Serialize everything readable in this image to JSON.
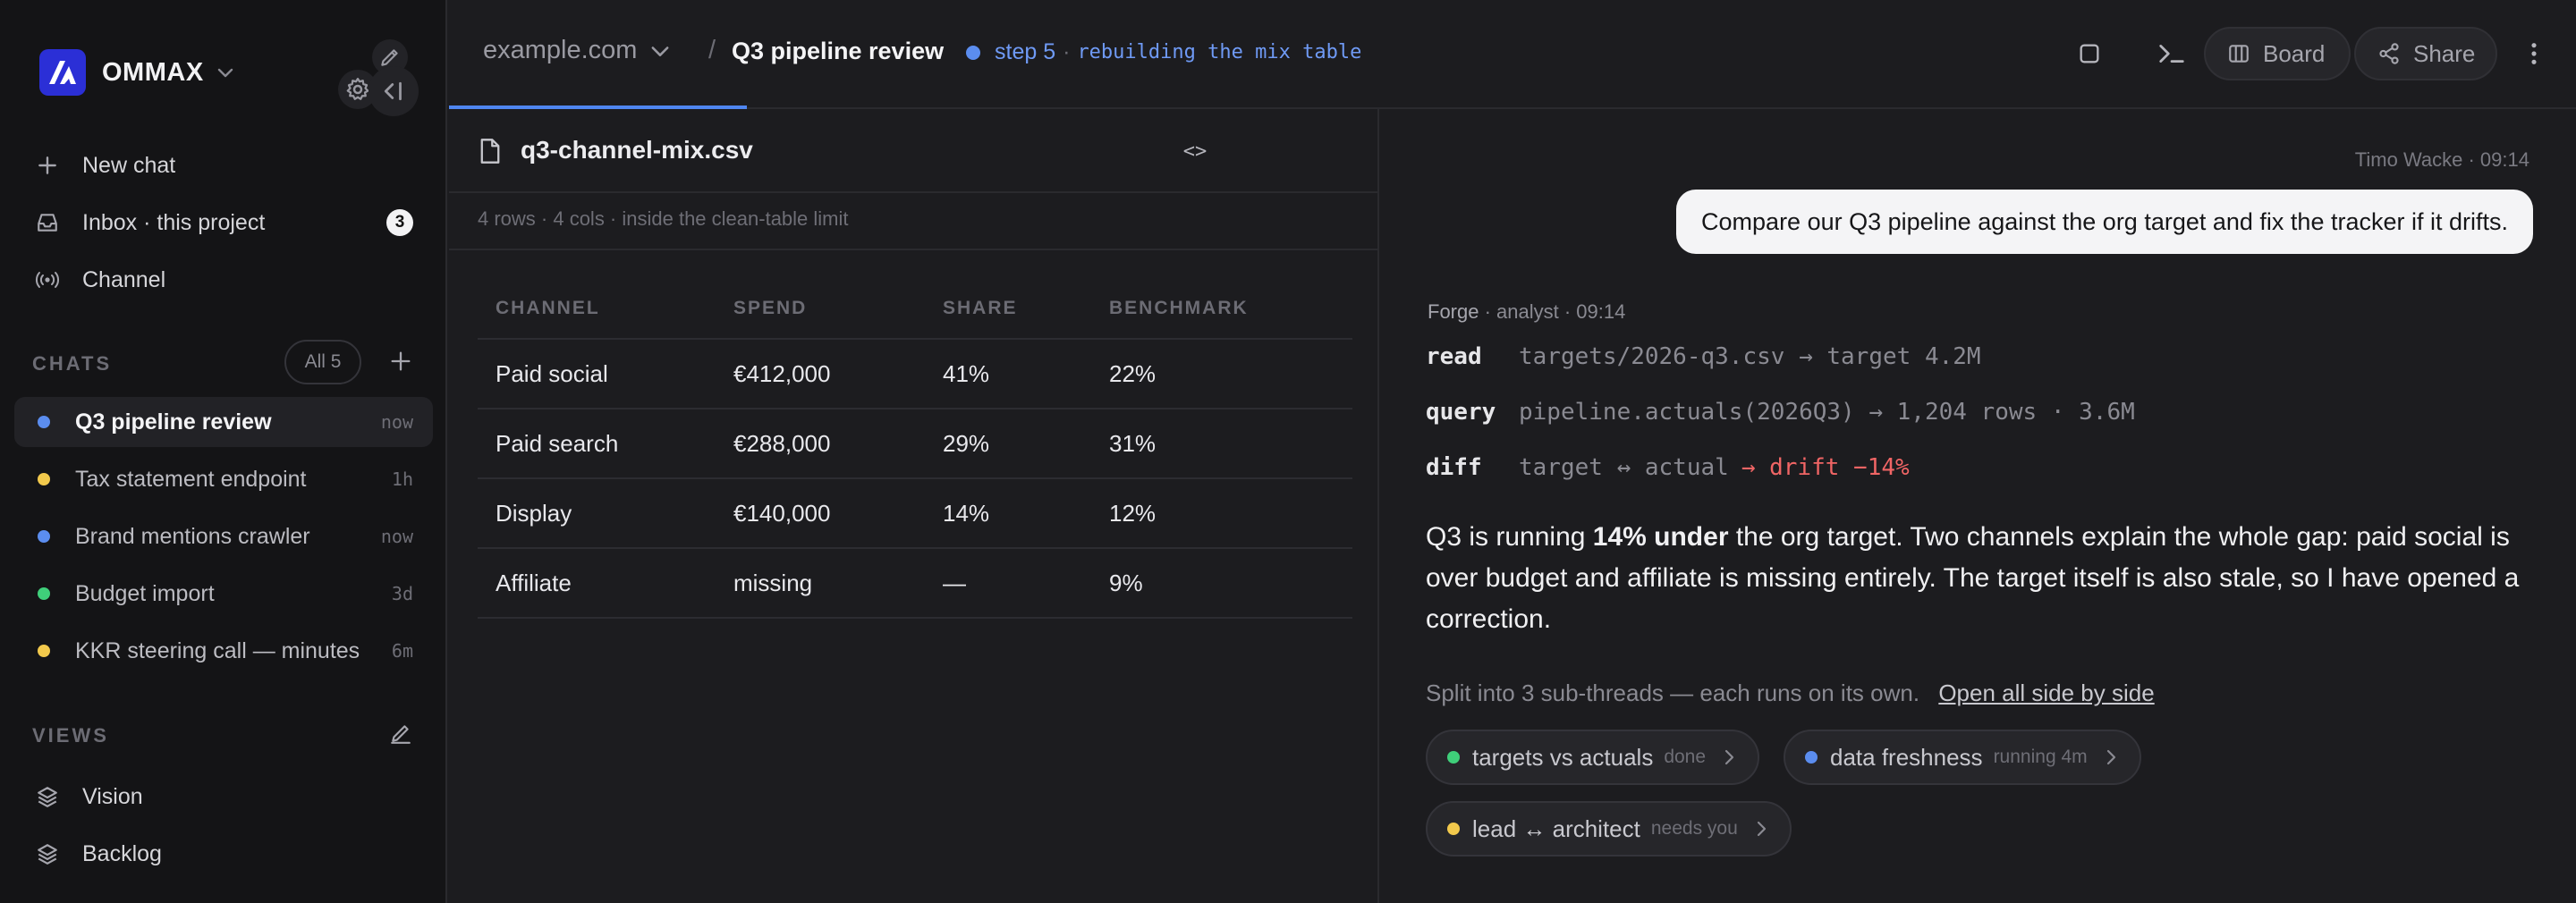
{
  "colors": {
    "accent_blue": "#5b8def",
    "dot_blue": "#5b8def",
    "dot_yellow": "#f2c94c",
    "dot_green": "#3fcf7a",
    "alert_red": "#f06565",
    "brand": "#2b2fd6"
  },
  "sidebar": {
    "brand_name": "OMMAX",
    "nav": [
      {
        "label": "New chat",
        "icon": "plus-icon"
      },
      {
        "label": "Inbox · this project",
        "icon": "inbox-icon",
        "badge": "3"
      },
      {
        "label": "Channel",
        "icon": "broadcast-icon"
      }
    ],
    "chats_label": "CHATS",
    "all_label": "All 5",
    "chats": [
      {
        "label": "Q3 pipeline review",
        "time": "now",
        "dot": "#5b8def"
      },
      {
        "label": "Tax statement endpoint",
        "time": "1h",
        "dot": "#f2c94c"
      },
      {
        "label": "Brand mentions crawler",
        "time": "now",
        "dot": "#5b8def"
      },
      {
        "label": "Budget import",
        "time": "3d",
        "dot": "#3fcf7a"
      },
      {
        "label": "KKR steering call — minutes",
        "time": "6m",
        "dot": "#f2c94c"
      }
    ],
    "views_label": "VIEWS",
    "views": [
      {
        "label": "Vision",
        "icon": "layers-icon"
      },
      {
        "label": "Backlog",
        "icon": "layers-icon"
      }
    ]
  },
  "topbar": {
    "domain": "example.com",
    "separator": "/",
    "title": "Q3 pipeline review",
    "step_label": "step 5",
    "step_sep": "·",
    "step_desc": "rebuilding the mix table",
    "progress": 0.14,
    "board_label": "Board",
    "share_label": "Share"
  },
  "file": {
    "name": "q3-channel-mix.csv",
    "toggle": "<>",
    "meta": "4 rows · 4 cols · inside the clean-table limit",
    "columns": [
      "CHANNEL",
      "SPEND",
      "SHARE",
      "BENCHMARK"
    ],
    "rows": [
      [
        "Paid social",
        "€412,000",
        "41%",
        "22%"
      ],
      [
        "Paid search",
        "€288,000",
        "29%",
        "31%"
      ],
      [
        "Display",
        "€140,000",
        "14%",
        "12%"
      ],
      [
        "Affiliate",
        "missing",
        "—",
        "9%"
      ]
    ]
  },
  "chat": {
    "user_meta": "Timo Wacke · 09:14",
    "user_message": "Compare our Q3 pipeline against the org target and fix the tracker if it drifts.",
    "agent_name": "Forge",
    "agent_role": "· analyst · 09:14",
    "tools": [
      {
        "verb": "read",
        "arg": "targets/2026-q3.csv → target 4.2M",
        "alert": ""
      },
      {
        "verb": "query",
        "arg": "pipeline.actuals(2026Q3) → 1,204 rows · 3.6M",
        "alert": ""
      },
      {
        "verb": "diff",
        "arg": "target ↔ actual",
        "alert": "→ drift −14%"
      }
    ],
    "answer_pre": "Q3 is running ",
    "answer_bold": "14% under",
    "answer_post": " the org target. Two channels explain the whole gap: paid social is over budget and affiliate is missing entirely. The target itself is also stale, so I have opened a correction.",
    "split_text": "Split into 3 sub-threads — each runs on its own.",
    "split_link": "Open all side by side",
    "threads": [
      {
        "label": "targets vs actuals",
        "status": "done",
        "dot": "#3fcf7a"
      },
      {
        "label": "data freshness",
        "status": "running 4m",
        "dot": "#5b8def"
      },
      {
        "label": "lead ↔ architect",
        "status": "needs you",
        "dot": "#f2c94c"
      }
    ]
  }
}
